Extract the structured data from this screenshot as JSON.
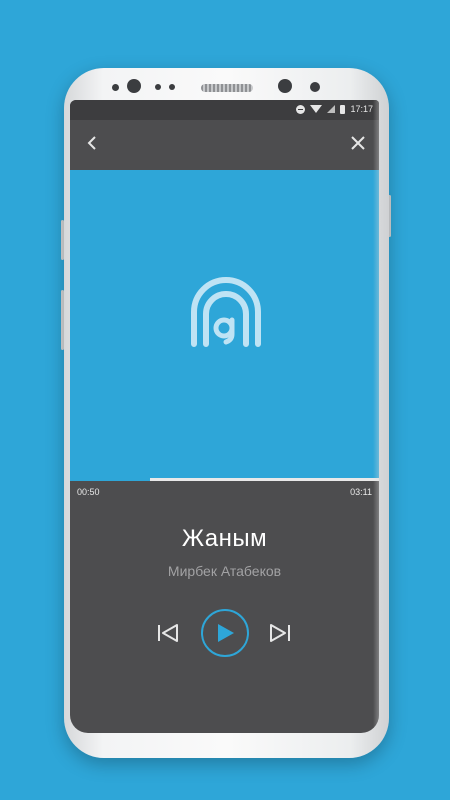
{
  "status_bar": {
    "time": "17:17",
    "icons": [
      "do-not-disturb-icon",
      "wifi-icon",
      "signal-icon",
      "battery-icon"
    ]
  },
  "nav": {
    "back_icon": "chevron-left-icon",
    "close_icon": "close-icon"
  },
  "artwork": {
    "logo_icon": "qazaq-music-logo-icon",
    "background_color": "#2ea6d8"
  },
  "player": {
    "elapsed": "00:50",
    "total": "03:11",
    "progress_fraction": 0.26,
    "title": "Жаным",
    "artist": "Мирбек Атабеков",
    "controls": {
      "previous_icon": "skip-previous-icon",
      "play_icon": "play-icon",
      "next_icon": "skip-next-icon"
    }
  },
  "colors": {
    "accent": "#2ea6d8",
    "page_background": "#2ea6d8",
    "screen_background": "#4d4d4f",
    "title_text": "#ffffff",
    "artist_text": "#a2a2a4"
  }
}
